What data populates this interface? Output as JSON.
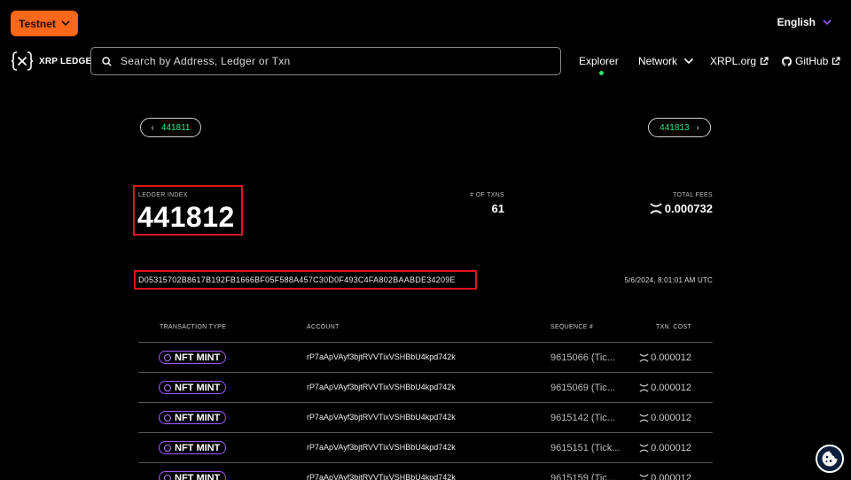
{
  "header": {
    "network_button": "Testnet",
    "language": "English",
    "logo_text": "XRP LEDGER",
    "search": {
      "placeholder": "Search by Address, Ledger or Txn"
    },
    "nav": {
      "explorer": "Explorer",
      "network": "Network",
      "xrpl": "XRPL.org",
      "github": "GitHub"
    }
  },
  "ledger": {
    "prev": "441811",
    "next": "441813",
    "index_label": "LEDGER INDEX",
    "index": "441812",
    "txns_label": "# OF TXNS",
    "txns": "61",
    "fees_label": "TOTAL FEES",
    "fees": "0.000732",
    "hash": "D05315702B8617B192FB1666BF05F588A457C30D0F493C4FA802BAABDE34209E",
    "close_time": "5/6/2024, 8:01:01 AM UTC"
  },
  "table": {
    "headers": {
      "type": "TRANSACTION TYPE",
      "account": "ACCOUNT",
      "sequence": "SEQUENCE #",
      "cost": "TXN. COST"
    },
    "rows": [
      {
        "type": "NFT MINT",
        "account": "rP7aApVAyf3bjtRVVTixVSHBbU4kpd742k",
        "sequence": "9615066 (Tic...",
        "cost": "0.000012"
      },
      {
        "type": "NFT MINT",
        "account": "rP7aApVAyf3bjtRVVTixVSHBbU4kpd742k",
        "sequence": "9615069 (Tic...",
        "cost": "0.000012"
      },
      {
        "type": "NFT MINT",
        "account": "rP7aApVAyf3bjtRVVTixVSHBbU4kpd742k",
        "sequence": "9615142 (Tic...",
        "cost": "0.000012"
      },
      {
        "type": "NFT MINT",
        "account": "rP7aApVAyf3bjtRVVTixVSHBbU4kpd742k",
        "sequence": "9615151 (Tick...",
        "cost": "0.000012"
      },
      {
        "type": "NFT MINT",
        "account": "rP7aApVAyf3bjtRVVTixVSHBbU4kpd742k",
        "sequence": "9615159 (Tic...",
        "cost": "0.000012"
      }
    ]
  },
  "colors": {
    "accent_orange": "#ff6719",
    "link_green": "#32e685",
    "badge_purple": "#a35cff",
    "highlight_red": "#e0151b"
  },
  "icons": [
    "chevron-down-icon",
    "xrp-logo-icon",
    "search-icon",
    "external-link-icon",
    "github-icon",
    "xrp-icon",
    "cookie-icon"
  ]
}
